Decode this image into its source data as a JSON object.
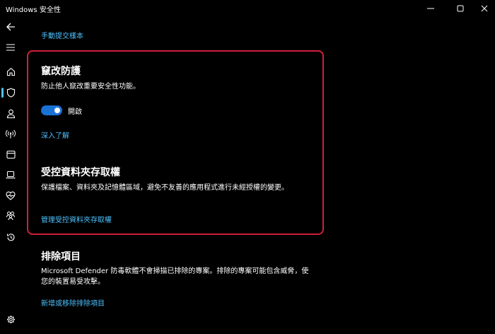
{
  "window": {
    "title": "Windows 安全性"
  },
  "rail": {
    "items": [
      {
        "name": "back-arrow-icon"
      },
      {
        "name": "hamburger-menu-icon"
      },
      {
        "name": "home-icon"
      },
      {
        "name": "shield-icon"
      },
      {
        "name": "person-icon"
      },
      {
        "name": "wireless-antenna-icon"
      },
      {
        "name": "app-browser-icon"
      },
      {
        "name": "laptop-icon"
      },
      {
        "name": "heart-pulse-icon"
      },
      {
        "name": "family-icon"
      },
      {
        "name": "history-icon"
      },
      {
        "name": "gear-icon"
      }
    ],
    "selected": "shield-icon"
  },
  "top_link": "手動提交樣本",
  "tamper": {
    "title": "竄改防護",
    "description": "防止他人竄改重要安全性功能。",
    "toggle_on": true,
    "toggle_label": "開啟",
    "learn_more": "深入了解"
  },
  "folder_access": {
    "title": "受控資料夾存取權",
    "description": "保護檔案、資料夾及記憶體區域，避免不友善的應用程式進行未經授權的變更。",
    "manage_link": "管理受控資料夾存取權"
  },
  "exclusions": {
    "title": "排除項目",
    "description": "Microsoft Defender 防毒軟體不會掃描已排除的專案。排除的專案可能包含威脅，使您的裝置易受攻擊。",
    "manage_link": "新增或移除排除項目"
  },
  "colors": {
    "accent": "#4cc2ff",
    "toggle_on": "#1a72d6",
    "highlight_border": "#d11f3a",
    "background": "#000000"
  }
}
